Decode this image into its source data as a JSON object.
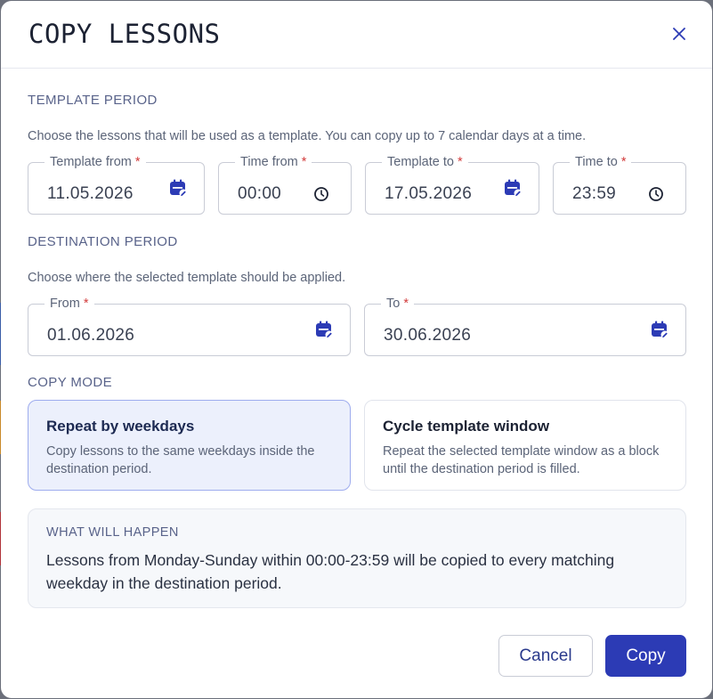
{
  "dialog": {
    "title": "COPY LESSONS",
    "close_icon": "close-icon"
  },
  "template_period": {
    "label": "TEMPLATE PERIOD",
    "description": "Choose the lessons that will be used as a template. You can copy up to 7 calendar days at a time.",
    "fields": {
      "template_from": {
        "label": "Template from",
        "required": "*",
        "value": "11.05.2026",
        "icon": "calendar-icon"
      },
      "time_from": {
        "label": "Time from",
        "required": "*",
        "value": "00:00",
        "icon": "clock-icon"
      },
      "template_to": {
        "label": "Template to",
        "required": "*",
        "value": "17.05.2026",
        "icon": "calendar-icon"
      },
      "time_to": {
        "label": "Time to",
        "required": "*",
        "value": "23:59",
        "icon": "clock-icon"
      }
    }
  },
  "destination_period": {
    "label": "DESTINATION PERIOD",
    "description": "Choose where the selected template should be applied.",
    "fields": {
      "from": {
        "label": "From",
        "required": "*",
        "value": "01.06.2026",
        "icon": "calendar-icon"
      },
      "to": {
        "label": "To",
        "required": "*",
        "value": "30.06.2026",
        "icon": "calendar-icon"
      }
    }
  },
  "copy_mode": {
    "label": "COPY MODE",
    "options": [
      {
        "title": "Repeat by weekdays",
        "description": "Copy lessons to the same weekdays inside the destination period.",
        "selected": true
      },
      {
        "title": "Cycle template window",
        "description": "Repeat the selected template window as a block until the destination period is filled.",
        "selected": false
      }
    ]
  },
  "summary": {
    "label": "WHAT WILL HAPPEN",
    "text": "Lessons from Monday-Sunday within 00:00-23:59 will be copied to every matching weekday in the destination period."
  },
  "actions": {
    "cancel_label": "Cancel",
    "copy_label": "Copy"
  },
  "colors": {
    "accent": "#2c3bb5",
    "selected_card_bg": "#ecf0fc",
    "required": "#d23b3b"
  }
}
